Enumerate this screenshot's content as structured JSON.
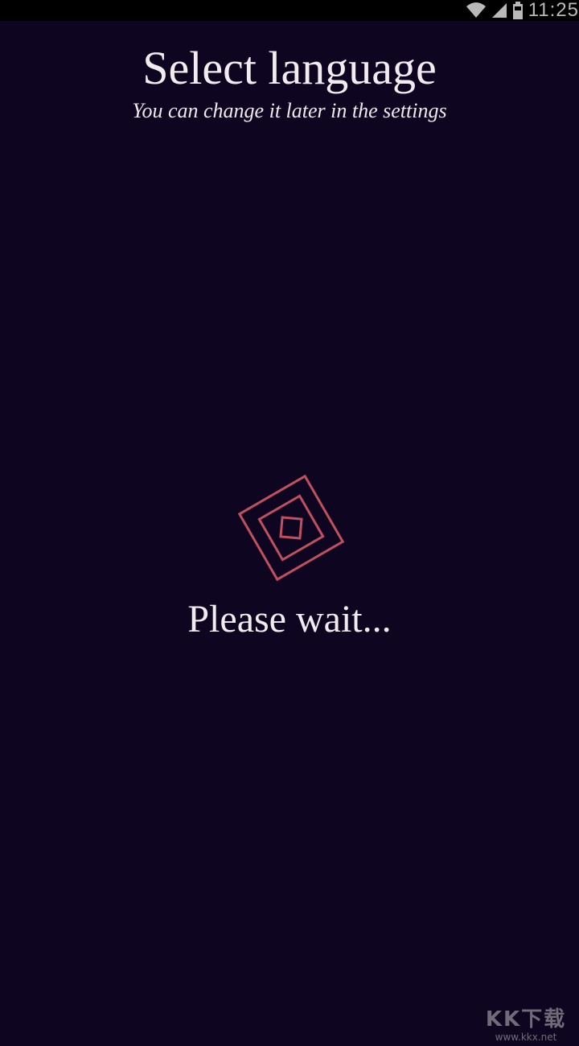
{
  "status_bar": {
    "time": "11:25",
    "icons": [
      "wifi-icon",
      "cellular-signal-icon",
      "battery-icon"
    ]
  },
  "header": {
    "title": "Select language",
    "subtitle": "You can change it later in the settings"
  },
  "loading": {
    "message": "Please wait...",
    "icon": "loading-diamond-icon",
    "accent_color": "#c0505f"
  },
  "watermark": {
    "logo": "KK下载",
    "url": "www.kkx.net"
  },
  "colors": {
    "background": "#0e0621",
    "text": "#f2ecef",
    "status_bar": "#000000"
  }
}
